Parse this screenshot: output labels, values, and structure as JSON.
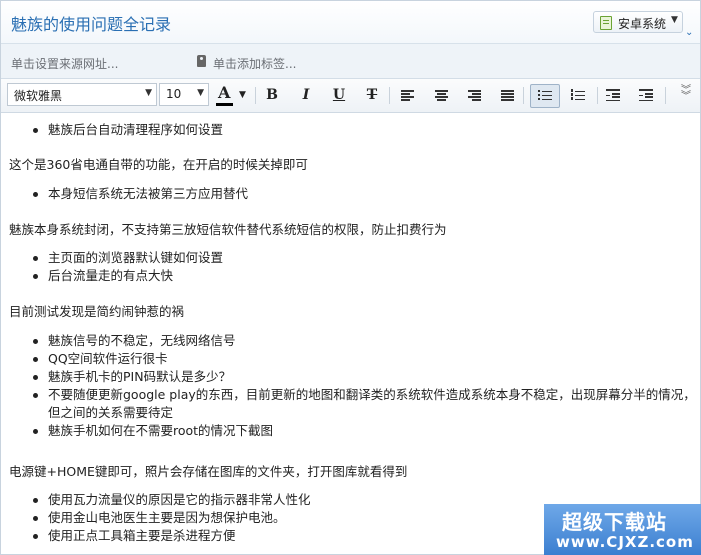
{
  "header": {
    "title": "魅族的使用问题全记录",
    "notebook_label": "安卓系统"
  },
  "meta": {
    "source_placeholder": "单击设置来源网址...",
    "tag_placeholder": "单击添加标签..."
  },
  "toolbar": {
    "font_family": "微软雅黑",
    "font_size": "10",
    "color_letter": "A",
    "bold": "B",
    "italic": "I",
    "underline": "U",
    "strike": "T",
    "text_color": "#000000"
  },
  "content": {
    "list1": [
      "魅族后台自动清理程序如何设置"
    ],
    "para1": "这个是360省电通自带的功能，在开启的时候关掉即可",
    "list2": [
      "本身短信系统无法被第三方应用替代"
    ],
    "para2": "魅族本身系统封闭，不支持第三放短信软件替代系统短信的权限，防止扣费行为",
    "list3": [
      "主页面的浏览器默认键如何设置",
      "后台流量走的有点大快"
    ],
    "para3": "目前测试发现是简约闹钟惹的祸",
    "list4": [
      "魅族信号的不稳定，无线网络信号",
      "QQ空间软件运行很卡",
      "魅族手机卡的PIN码默认是多少？",
      "不要随便更新google play的东西，目前更新的地图和翻译类的系统软件造成系统本身不稳定，出现屏幕分半的情况，但之间的关系需要待定",
      "魅族手机如何在不需要root的情况下截图"
    ],
    "para4": "电源键+HOME键即可，照片会存储在图库的文件夹，打开图库就看得到",
    "list5": [
      "使用瓦力流量仪的原因是它的指示器非常人性化",
      "使用金山电池医生主要是因为想保护电池。",
      "使用正点工具箱主要是杀进程方便"
    ]
  },
  "watermark": {
    "line1": "超级下载站",
    "line2": "www.CJXZ.com"
  }
}
